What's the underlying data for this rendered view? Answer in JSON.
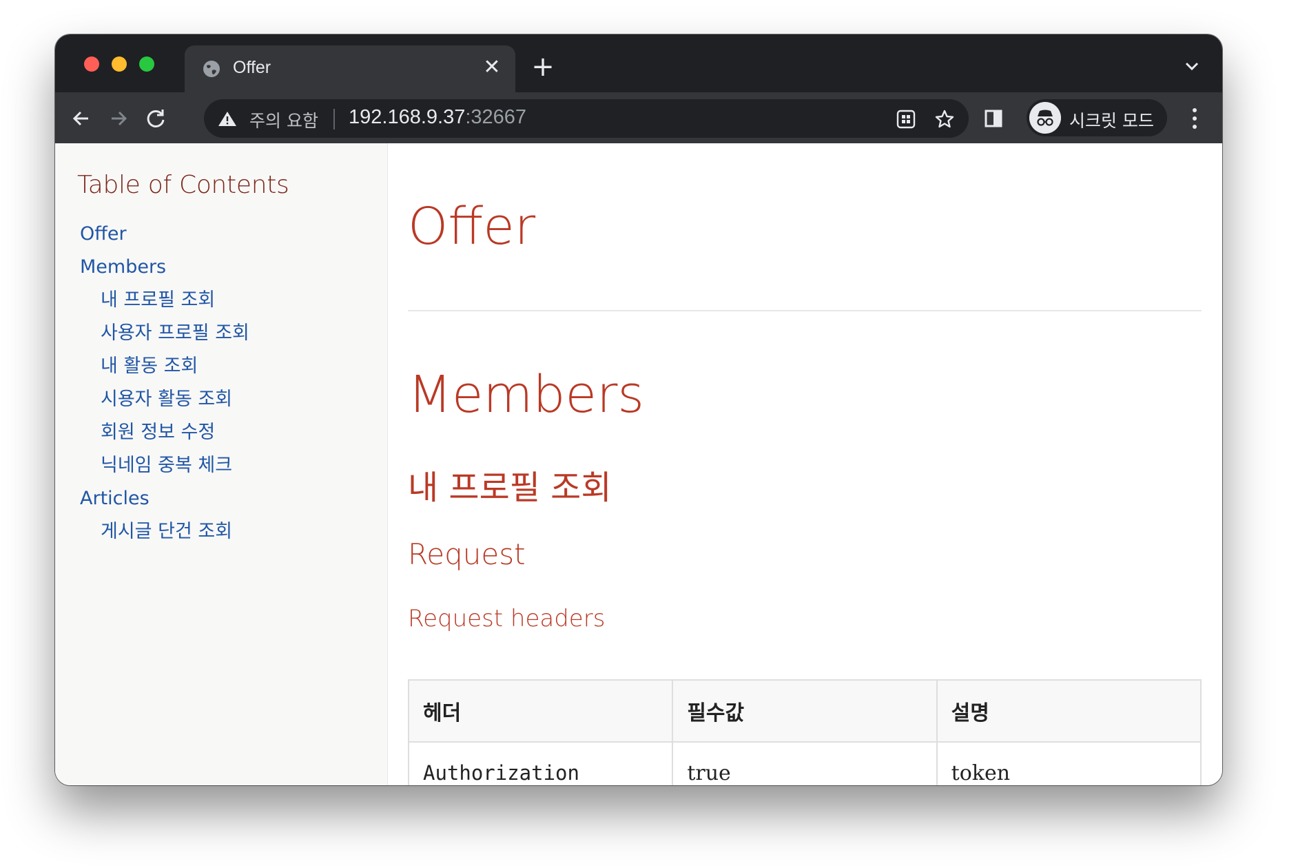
{
  "browser": {
    "tab_title": "Offer",
    "tab_close_glyph": "✕",
    "new_tab_glyph": "+",
    "security_warning": "주의 요함",
    "url_host": "192.168.9.37",
    "url_port": ":32667",
    "profile_label": "시크릿 모드",
    "icons": [
      "globe-icon",
      "close-icon",
      "plus-icon",
      "chevron-down-icon",
      "back-icon",
      "forward-icon",
      "reload-icon",
      "warning-icon",
      "install-app-icon",
      "bookmark-star-icon",
      "side-panel-icon",
      "incognito-icon",
      "more-menu-icon"
    ]
  },
  "sidebar": {
    "title": "Table of Contents",
    "items": [
      {
        "label": "Offer",
        "level": 1
      },
      {
        "label": "Members",
        "level": 1
      },
      {
        "label": "내 프로필 조회",
        "level": 2
      },
      {
        "label": "사용자 프로필 조회",
        "level": 2
      },
      {
        "label": "내 활동 조회",
        "level": 2
      },
      {
        "label": "시용자 활동 조회",
        "level": 2
      },
      {
        "label": "회원 정보 수정",
        "level": 2
      },
      {
        "label": "닉네임 중복 체크",
        "level": 2
      },
      {
        "label": "Articles",
        "level": 1
      },
      {
        "label": "게시글 단건 조회",
        "level": 2
      }
    ]
  },
  "main": {
    "h_offer": "Offer",
    "h_members": "Members",
    "h_profile": "내 프로필 조회",
    "h_request": "Request",
    "h_request_headers": "Request headers",
    "table": {
      "headers": [
        "헤더",
        "필수값",
        "설명"
      ],
      "rows": [
        [
          "Authorization",
          "true",
          "token"
        ]
      ]
    }
  },
  "colors": {
    "heading": "#ba3925",
    "toc_title": "#7a2518",
    "link": "#2156a5",
    "chrome_dark": "#1f2024",
    "chrome_toolbar": "#35363a"
  }
}
